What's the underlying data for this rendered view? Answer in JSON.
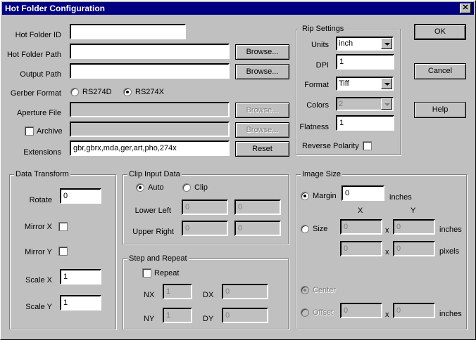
{
  "window": {
    "title": "Hot Folder Configuration",
    "close_glyph": "✕"
  },
  "labels": {
    "hot_folder_id": "Hot Folder ID",
    "hot_folder_path": "Hot Folder Path",
    "output_path": "Output Path",
    "gerber_format": "Gerber Format",
    "aperture_file": "Aperture File",
    "archive": "Archive",
    "extensions": "Extensions"
  },
  "fields": {
    "hot_folder_id": "",
    "hot_folder_path": "",
    "output_path": "",
    "aperture_file": "",
    "archive": "",
    "extensions": "gbr,gbrx,mda,ger,art,pho,274x"
  },
  "gerber_format": {
    "options": [
      "RS274D",
      "RS274X"
    ],
    "selected": "RS274X"
  },
  "buttons": {
    "browse": "Browse...",
    "reset": "Reset",
    "ok": "OK",
    "cancel": "Cancel",
    "help": "Help"
  },
  "rip_settings": {
    "title": "Rip Settings",
    "units_label": "Units",
    "units_value": "inch",
    "dpi_label": "DPI",
    "dpi_value": "1",
    "format_label": "Format",
    "format_value": "Tiff",
    "colors_label": "Colors",
    "colors_value": "2",
    "flatness_label": "Flatness",
    "flatness_value": "1",
    "reverse_polarity_label": "Reverse Polarity"
  },
  "data_transform": {
    "title": "Data Transform",
    "rotate_label": "Rotate",
    "rotate_value": "0",
    "mirror_x_label": "Mirror X",
    "mirror_y_label": "Mirror Y",
    "scale_x_label": "Scale X",
    "scale_x_value": "1",
    "scale_y_label": "Scale Y",
    "scale_y_value": "1"
  },
  "clip_input": {
    "title": "Clip Input Data",
    "auto_label": "Auto",
    "clip_label": "Clip",
    "lower_left_label": "Lower Left",
    "upper_right_label": "Upper Right",
    "ll_x": "0",
    "ll_y": "0",
    "ur_x": "0",
    "ur_y": "0"
  },
  "step_repeat": {
    "title": "Step and Repeat",
    "repeat_label": "Repeat",
    "nx_label": "NX",
    "nx_value": "1",
    "ny_label": "NY",
    "ny_value": "1",
    "dx_label": "DX",
    "dx_value": "0",
    "dy_label": "DY",
    "dy_value": "0"
  },
  "image_size": {
    "title": "Image Size",
    "margin_label": "Margin",
    "margin_value": "0",
    "inches": "inches",
    "x_header": "X",
    "y_header": "Y",
    "size_label": "Size",
    "size_x": "0",
    "size_y": "0",
    "pixels": "pixels",
    "px_x": "0",
    "px_y": "0",
    "times": "x",
    "center_label": "Center",
    "offset_label": "Offset",
    "offset_x": "0",
    "offset_y": "0"
  }
}
